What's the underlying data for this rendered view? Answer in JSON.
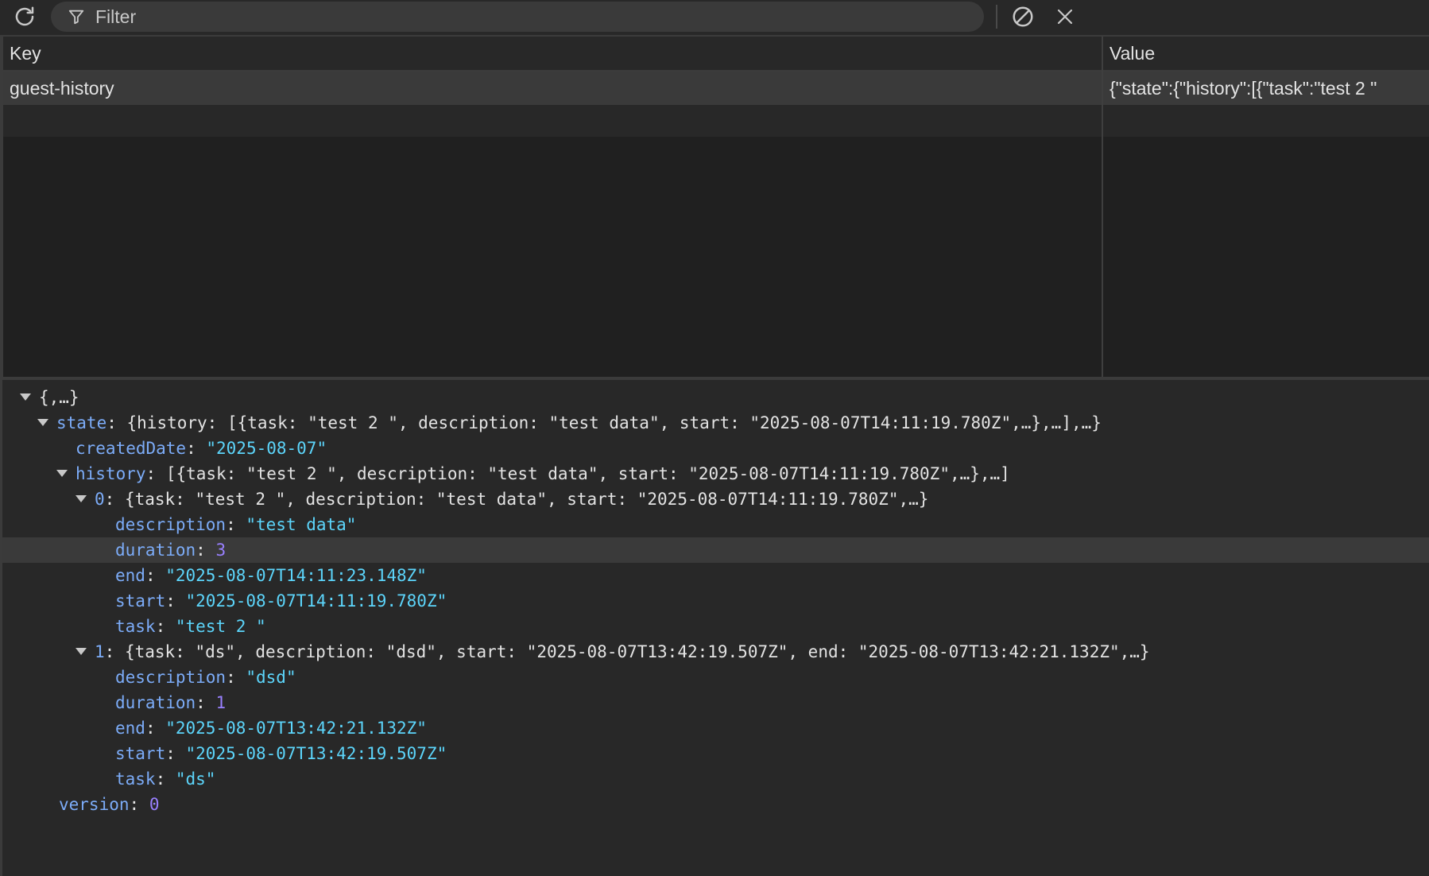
{
  "toolbar": {
    "filter_placeholder": "Filter",
    "icons": [
      "refresh-icon",
      "filter-icon",
      "clear-all-icon",
      "delete-icon"
    ]
  },
  "table": {
    "columns": [
      "Key",
      "Value"
    ],
    "rows": [
      {
        "key": "guest-history",
        "value": "{\"state\":{\"history\":[{\"task\":\"test 2 \""
      }
    ]
  },
  "tree": {
    "root_preview": "{,…}",
    "state": {
      "key": "state",
      "preview": "{history: [{task: \"test 2 \", description: \"test data\", start: \"2025-08-07T14:11:19.780Z\",…},…],…}",
      "createdDate": {
        "key": "createdDate",
        "value": "\"2025-08-07\""
      },
      "history": {
        "key": "history",
        "preview": "[{task: \"test 2 \", description: \"test data\", start: \"2025-08-07T14:11:19.780Z\",…},…]",
        "items": [
          {
            "index": "0",
            "preview": "{task: \"test 2 \", description: \"test data\", start: \"2025-08-07T14:11:19.780Z\",…}",
            "description": "\"test data\"",
            "duration": "3",
            "end": "\"2025-08-07T14:11:23.148Z\"",
            "start": "\"2025-08-07T14:11:19.780Z\"",
            "task": "\"test 2 \""
          },
          {
            "index": "1",
            "preview": "{task: \"ds\", description: \"dsd\", start: \"2025-08-07T13:42:19.507Z\", end: \"2025-08-07T13:42:21.132Z\",…}",
            "description": "\"dsd\"",
            "duration": "1",
            "end": "\"2025-08-07T13:42:21.132Z\"",
            "start": "\"2025-08-07T13:42:19.507Z\"",
            "task": "\"ds\""
          }
        ]
      }
    },
    "version": {
      "key": "version",
      "value": "0"
    },
    "field_keys": {
      "description": "description",
      "duration": "duration",
      "end": "end",
      "start": "start",
      "task": "task"
    }
  },
  "colors": {
    "background": "#282828",
    "key": "#7cacf8",
    "string": "#5cd5fb",
    "number": "#9980ff",
    "selected_row": "#3a3a3a"
  }
}
